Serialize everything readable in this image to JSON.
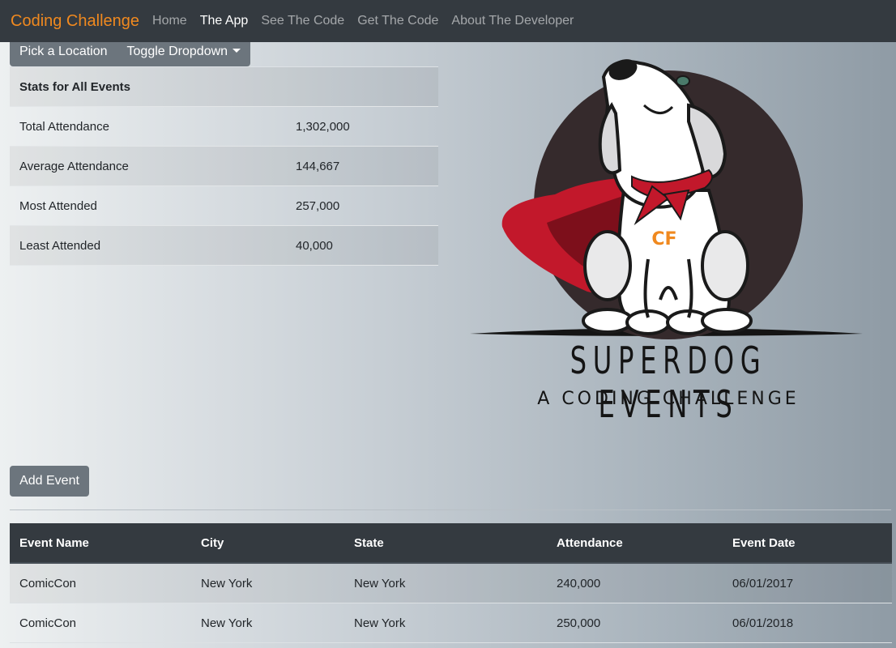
{
  "navbar": {
    "brand": "Coding Challenge",
    "links": [
      "Home",
      "The App",
      "See The Code",
      "Get The Code",
      "About The Developer"
    ],
    "active": "The App"
  },
  "location_picker": {
    "label": "Pick a Location",
    "toggle_label": "Toggle Dropdown"
  },
  "stats": {
    "heading": "Stats for All Events",
    "rows": [
      {
        "label": "Total Attendance",
        "value": "1,302,000"
      },
      {
        "label": "Average Attendance",
        "value": "144,667"
      },
      {
        "label": "Most Attended",
        "value": "257,000"
      },
      {
        "label": "Least Attended",
        "value": "40,000"
      }
    ]
  },
  "logo": {
    "badge": "CF",
    "title": "SUPERDOG EVENTS",
    "subtitle": "A CODING CHALLENGE"
  },
  "add_event_label": "Add Event",
  "events_table": {
    "columns": [
      "Event Name",
      "City",
      "State",
      "Attendance",
      "Event Date"
    ],
    "rows": [
      [
        "ComicCon",
        "New York",
        "New York",
        "240,000",
        "06/01/2017"
      ],
      [
        "ComicCon",
        "New York",
        "New York",
        "250,000",
        "06/01/2018"
      ]
    ]
  },
  "colors": {
    "navbar_bg": "#343a40",
    "brand": "#f0891f",
    "button_gray": "#6c757d",
    "cape_red": "#c2182b",
    "logo_circle": "#352a2c"
  }
}
